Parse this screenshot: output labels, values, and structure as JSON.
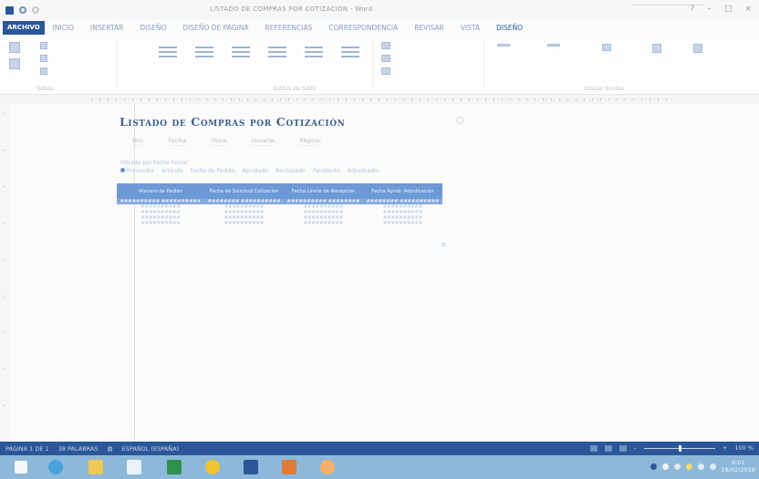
{
  "titlebar": {
    "doc_title": "LISTADO DE COMPRAS POR COTIZACION - Word"
  },
  "tabs": {
    "file": "ARCHIVO",
    "items": [
      "INICIO",
      "INSERTAR",
      "DISEÑO",
      "DISEÑO DE PÁGINA",
      "REFERENCIAS",
      "CORRESPONDENCIA",
      "REVISAR",
      "VISTA",
      "DISEÑO"
    ]
  },
  "ribbon": {
    "groups": [
      "Tablas",
      "Estilos de tabla",
      "Dibujar bordes"
    ]
  },
  "document": {
    "heading": "Listado de Compras por Cotización",
    "fields": [
      "Nro:",
      "Fecha:",
      "Hora:",
      "Usuario:",
      "Página:"
    ],
    "filter_label": "Filtrado por Fecha Inicial",
    "filter_options": [
      "Proveedor",
      "Artículo",
      "Fecha de Pedido",
      "Aprobado",
      "Rechazado",
      "Pendiente",
      "Adjudicado"
    ],
    "table": {
      "headers": [
        "Número de Pedido",
        "Fecha de Solicitud Cotización",
        "Fecha Límite de Recepción",
        "Fecha Aprob. Adjudicación"
      ],
      "rows": [
        [
          "########## ##########",
          "######## ##########",
          "########## ########",
          "######## ##########"
        ],
        [
          "##########",
          "##########",
          "##########",
          "##########"
        ],
        [
          "##########",
          "##########",
          "##########",
          "##########"
        ],
        [
          "##########",
          "##########",
          "##########",
          "##########"
        ],
        [
          "##########",
          "##########",
          "##########",
          "##########"
        ]
      ]
    }
  },
  "statusbar": {
    "page": "PÁGINA 1 DE 1",
    "words": "38 PALABRAS",
    "language": "ESPAÑOL (ESPAÑA)",
    "zoom": "100 %"
  },
  "taskbar": {
    "apps": [
      "start-icon",
      "ie-icon",
      "explorer-icon",
      "store-icon",
      "excel-icon",
      "chrome-icon",
      "word-icon",
      "powerpoint-icon",
      "paint-icon"
    ],
    "time": "9:01",
    "date": "18/02/2016"
  },
  "colors": {
    "word_blue": "#2b579a",
    "table_header": "#6d99d6",
    "taskbar": "#8db8d9"
  }
}
